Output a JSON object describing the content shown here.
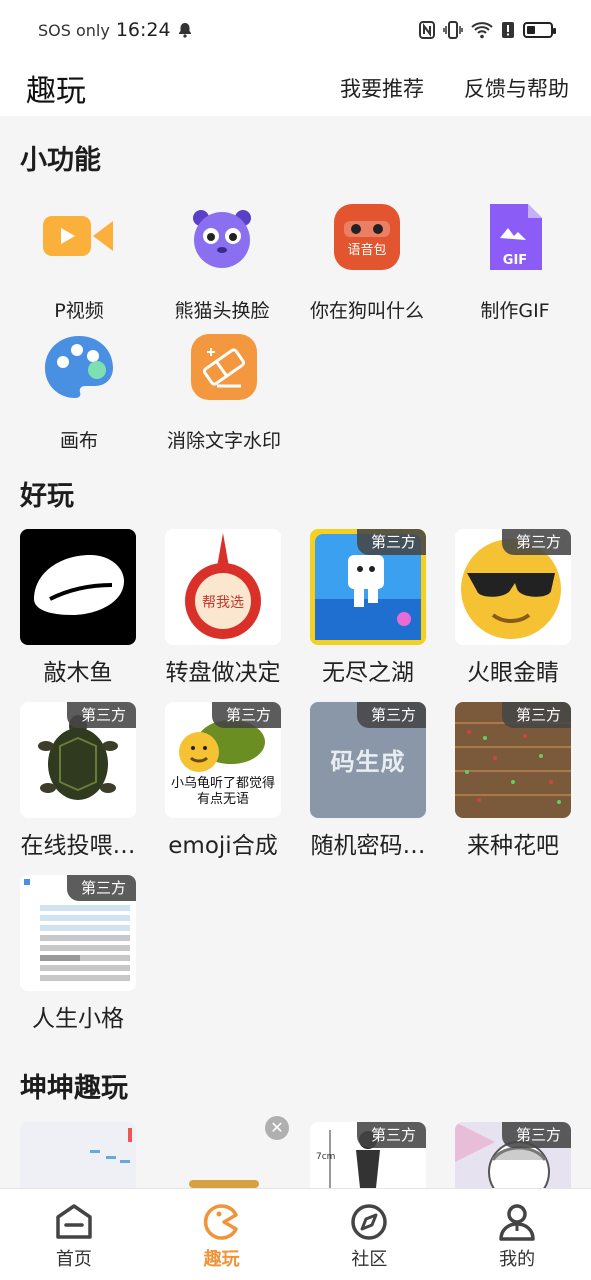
{
  "status_bar": {
    "carrier": "SOS only",
    "time": "16:24"
  },
  "header": {
    "title": "趣玩",
    "recommend": "我要推荐",
    "feedback": "反馈与帮助"
  },
  "sections": {
    "tools": "小功能",
    "fun": "好玩",
    "kunkun": "坤坤趣玩"
  },
  "tools": [
    {
      "label": "P视频",
      "icon": "video-camera-icon"
    },
    {
      "label": "熊猫头换脸",
      "icon": "panda-face-icon"
    },
    {
      "label": "你在狗叫什么",
      "icon": "voice-pack-icon",
      "icon_text": "语音包"
    },
    {
      "label": "制作GIF",
      "icon": "gif-file-icon",
      "icon_text": "GIF"
    },
    {
      "label": "画布",
      "icon": "palette-icon"
    },
    {
      "label": "消除文字水印",
      "icon": "eraser-icon"
    }
  ],
  "third_party_tag": "第三方",
  "games": [
    {
      "name": "敲木鱼",
      "third_party": false
    },
    {
      "name": "转盘做决定",
      "third_party": false,
      "thumb_text": "帮我选"
    },
    {
      "name": "无尽之湖",
      "third_party": true
    },
    {
      "name": "火眼金睛",
      "third_party": true
    },
    {
      "name": "在线投喂…",
      "third_party": true
    },
    {
      "name": "emoji合成",
      "third_party": true,
      "thumb_text": "小乌龟听了都觉得有点无语"
    },
    {
      "name": "随机密码…",
      "third_party": true,
      "thumb_text": "码生成"
    },
    {
      "name": "来种花吧",
      "third_party": true
    },
    {
      "name": "人生小格",
      "third_party": true
    }
  ],
  "kunkun_items": [
    {
      "third_party": false,
      "thumb_text": ""
    },
    {
      "third_party": false,
      "thumb_text": ""
    },
    {
      "third_party": true,
      "thumb_text": "7cm"
    },
    {
      "third_party": true,
      "thumb_text": ""
    }
  ],
  "nav": [
    {
      "label": "首页",
      "icon": "home-icon",
      "active": false
    },
    {
      "label": "趣玩",
      "icon": "pacman-icon",
      "active": true
    },
    {
      "label": "社区",
      "icon": "compass-icon",
      "active": false
    },
    {
      "label": "我的",
      "icon": "person-icon",
      "active": false
    }
  ],
  "colors": {
    "accent": "#f0943a",
    "tag_bg": "#464646"
  }
}
